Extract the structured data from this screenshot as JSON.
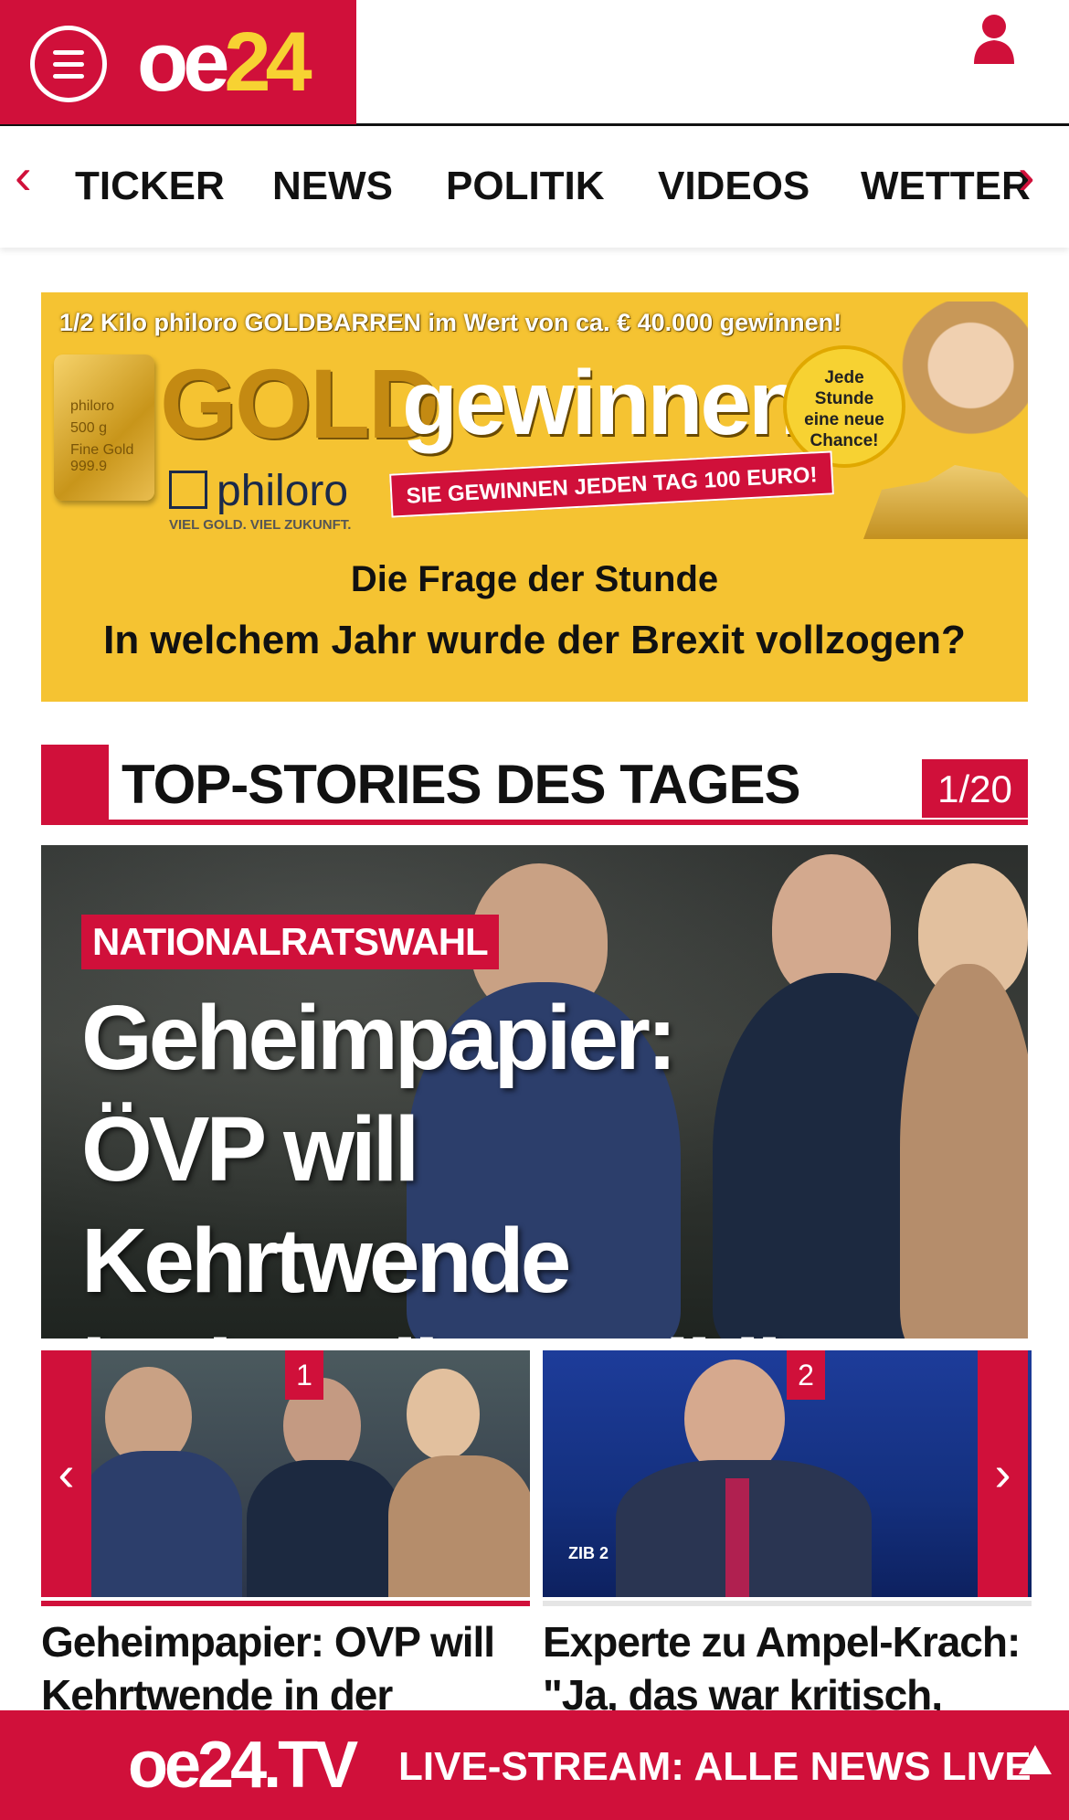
{
  "header": {
    "logo_oe": "oe",
    "logo_num": "24",
    "menu_icon": "hamburger-menu-icon",
    "user_icon": "user-icon",
    "colors": {
      "brand_red": "#d0103a",
      "logo_yellow": "#f7d232"
    }
  },
  "nav": {
    "prev_arrow": "‹",
    "next_arrow": "›",
    "items": [
      "TICKER",
      "NEWS",
      "POLITIK",
      "VIDEOS",
      "WETTER"
    ]
  },
  "banner": {
    "top_line": "1/2 Kilo philoro GOLDBARREN im Wert von ca. € 40.000 gewinnen!",
    "gold_word": "GOLD",
    "gewinnen": "gewinnen!",
    "circle_text": [
      "Jede",
      "Stunde",
      "eine neue",
      "Chance!"
    ],
    "brand": "philoro",
    "brand_sub": "VIEL GOLD. VIEL ZUKUNFT.",
    "red_strip": "SIE GEWINNEN JEDEN TAG 100 EURO!",
    "bar_lines": [
      "philoro",
      "500 g",
      "Fine Gold",
      "999.9"
    ],
    "question_title": "Die Frage der Stunde",
    "question_text": "In welchem Jahr wurde der Brexit vollzogen?",
    "colors": {
      "background": "#f5c332"
    }
  },
  "section": {
    "title": "TOP-STORIES DES TAGES",
    "counter": "1/20"
  },
  "hero": {
    "tag": "NATIONALRATSWAHL",
    "headline_lines": [
      "Geheimpapier:",
      "ÖVP will Kehrtwende",
      "in der Klimapolitik"
    ]
  },
  "cards": [
    {
      "number": "1",
      "title_lines": [
        "Geheimpapier: OVP will",
        "Kehrtwende in der"
      ]
    },
    {
      "number": "2",
      "title_lines": [
        "Experte zu Ampel-Krach:",
        "\"Ja, das war kritisch, keine"
      ],
      "overlay": "ZIB 2"
    }
  ],
  "slider": {
    "prev": "‹",
    "next": "›"
  },
  "live": {
    "logo": "oe24.TV",
    "text": "LIVE-STREAM:  ALLE NEWS LIVE",
    "up_icon": "scroll-up-icon"
  }
}
